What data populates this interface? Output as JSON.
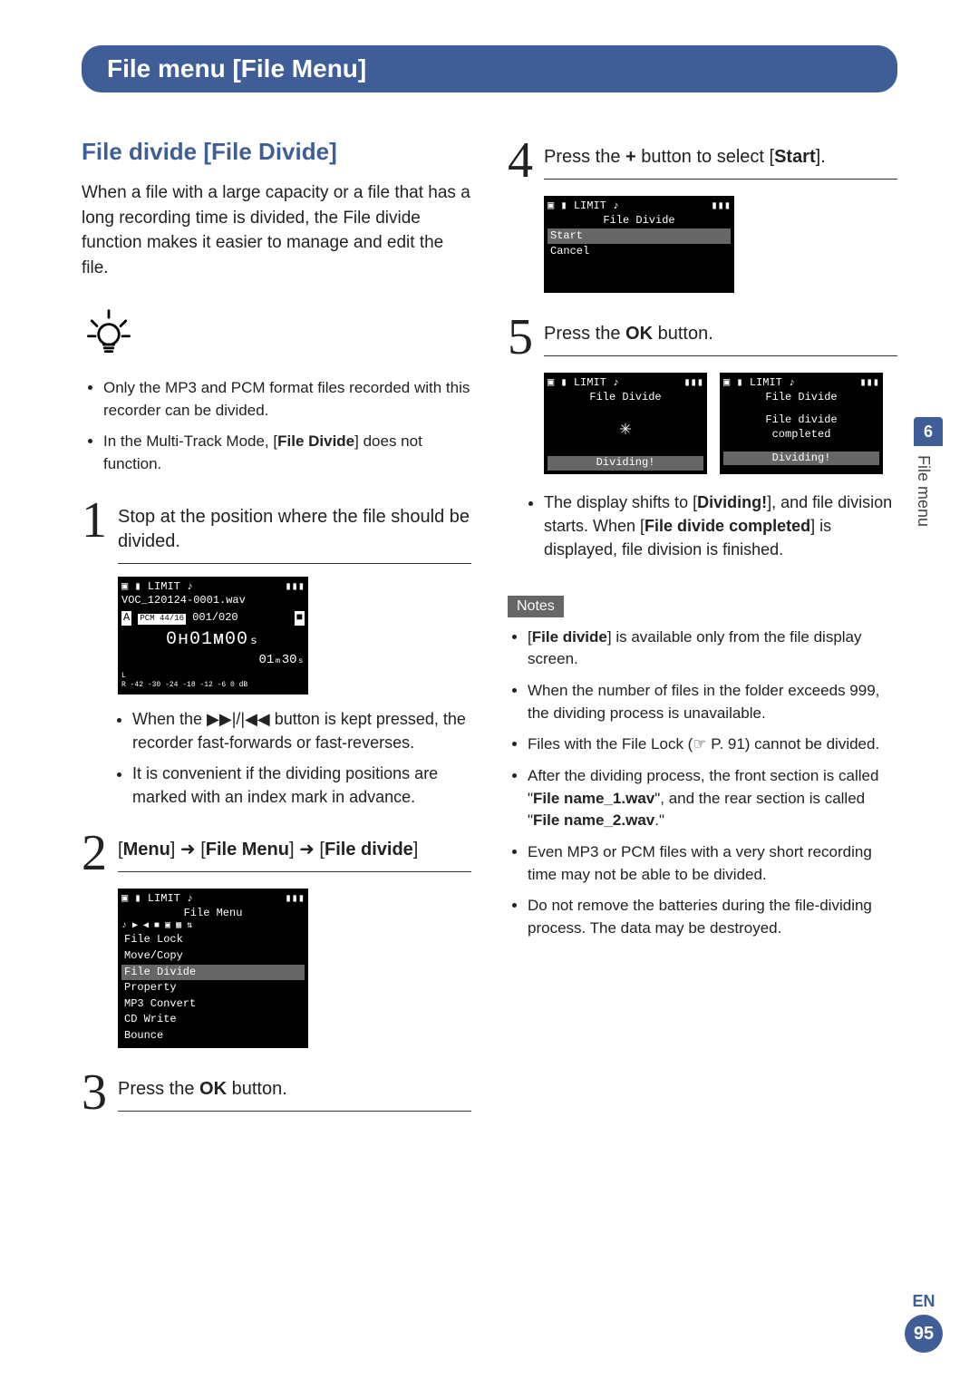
{
  "page_banner": "File menu [File Menu]",
  "section_title": "File divide [File Divide]",
  "intro": "When a file with a large capacity or a file that has a long recording time is divided, the File divide function makes it easier to manage and edit the file.",
  "tips": [
    "Only the MP3 and PCM format files recorded with this recorder can be divided.",
    "In the Multi-Track Mode, [<b>File Divide</b>] does not function."
  ],
  "steps": {
    "s1": {
      "num": "1",
      "text": "Stop at the position where the file should be divided."
    },
    "s1_screen": {
      "filename": "VOC_120124-0001.wav",
      "index": "001/020",
      "playback_letter": "A",
      "time_big": "0ʜ01ᴍ00ₛ",
      "time_small": "01ₘ30ₛ",
      "meter": "-42  -30   -24  -18  -12   -6    0  dB"
    },
    "s1_bullets": [
      "When the ▶▶|/|◀◀ button is kept pressed, the recorder fast-forwards or fast-reverses.",
      "It is convenient if the dividing positions are marked with an index mark in advance."
    ],
    "s2": {
      "num": "2",
      "text": "[<b>Menu</b>] ➜ [<b>File Menu</b>] ➜ [<b>File divide</b>]"
    },
    "s2_screen": {
      "title": "File Menu",
      "items": [
        "File Lock",
        "Move/Copy",
        "File Divide",
        "Property",
        "MP3 Convert",
        "CD Write",
        "Bounce"
      ],
      "highlight": 2
    },
    "s3": {
      "num": "3",
      "text": "Press the <b>OK</b> button."
    },
    "s4": {
      "num": "4",
      "text": "Press the <b>+</b> button to select [<b>Start</b>]."
    },
    "s4_screen": {
      "title": "File Divide",
      "items": [
        "Start",
        "Cancel"
      ],
      "highlight": 0
    },
    "s5": {
      "num": "5",
      "text": "Press the <b>OK</b> button."
    },
    "s5_screen_left": {
      "title": "File Divide",
      "status": "Dividing!"
    },
    "s5_screen_right": {
      "title": "File Divide",
      "msg": "File divide\ncompleted",
      "status": "Dividing!"
    },
    "s5_bullet": "The display shifts to [<b>Dividing!</b>], and file division starts. When [<b>File divide completed</b>] is displayed, file division is finished."
  },
  "notes_label": "Notes",
  "notes": [
    "[<b>File divide</b>] is available only from the file display screen.",
    "When the number of files in the folder exceeds 999, the dividing process is unavailable.",
    "Files with the File Lock (☞ P. 91) cannot be divided.",
    "After the dividing process, the front section is called \"<b>File name_1.wav</b>\", and the rear section is called \"<b>File name_2.wav</b>.\"",
    "Even MP3 or PCM files with a very short recording time may not be able to be divided.",
    "Do not remove the batteries during the file-dividing process. The data may be destroyed."
  ],
  "side_chapter": "6",
  "side_text": "File menu",
  "lang": "EN",
  "page_number": "95"
}
